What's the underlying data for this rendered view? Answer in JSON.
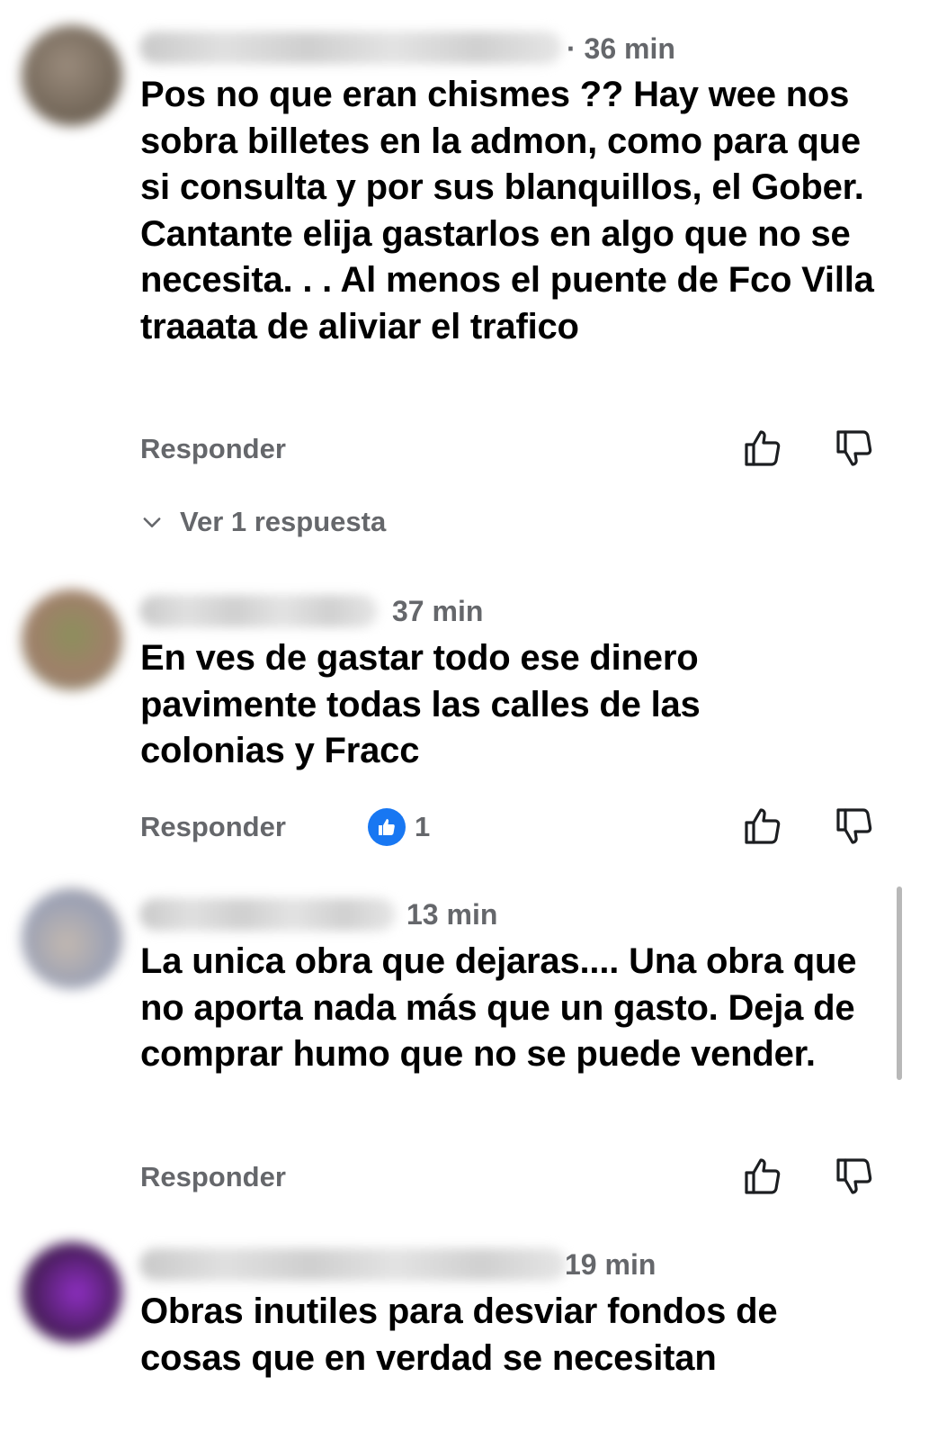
{
  "comments": [
    {
      "time": "· 36 min",
      "text": "Pos no que eran chismes ?? Hay wee nos sobra billetes en la admon, como para que si consulta y por sus blanquillos, el Gober. Cantante elija gastarlos en algo que no se necesita. . . Al menos el puente de Fco Villa traaata de aliviar el trafico",
      "reply_label": "Responder",
      "view_replies_label": "Ver 1 respuesta",
      "avatar_color": "#8a7a6a"
    },
    {
      "time": "37 min",
      "text": "En ves de gastar todo ese dinero pavimente todas las calles de las colonias y Fracc",
      "reply_label": "Responder",
      "reaction_count": "1",
      "avatar_color": "#8f8a6a"
    },
    {
      "time": "13 min",
      "text": "La unica obra que dejaras.... Una obra que no aporta nada más que un gasto. Deja de comprar humo que no se puede vender.",
      "reply_label": "Responder",
      "avatar_color": "#b0a6a0"
    },
    {
      "time": "19 min",
      "text": "Obras inutiles para desviar fondos de cosas que en verdad se necesitan",
      "avatar_color": "#6a2f86"
    }
  ],
  "icons": {
    "like": "thumbs-up-icon",
    "dislike": "thumbs-down-icon",
    "chevron": "chevron-down-icon",
    "reaction": "like-reaction-icon"
  },
  "colors": {
    "meta_gray": "#65676b",
    "reaction_blue": "#1877f2"
  }
}
